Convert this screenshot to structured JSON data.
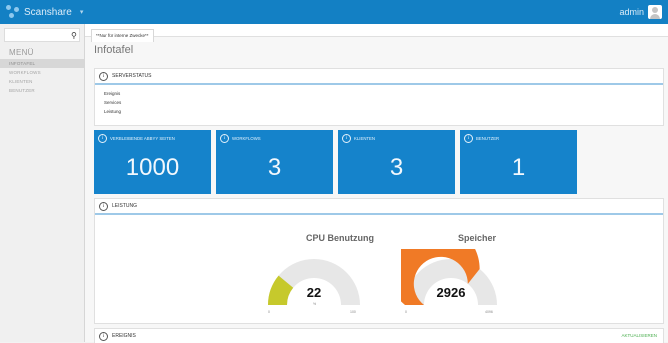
{
  "app": {
    "brand": "Scanshare",
    "user": "admin"
  },
  "sidebar": {
    "search_placeholder": "",
    "menu_title": "MENÜ",
    "items": [
      {
        "label": "INFOTAFEL"
      },
      {
        "label": "WORKFLOWS"
      },
      {
        "label": "KLIENTEN"
      },
      {
        "label": "BENUTZER"
      }
    ]
  },
  "tab": {
    "label": "**Nur für interne Zwecke**"
  },
  "page": {
    "title": "Infotafel"
  },
  "serverstatus": {
    "title": "SERVERSTATUS",
    "rows": [
      "Ereignis",
      "Services",
      "Leistung"
    ]
  },
  "tiles": [
    {
      "label": "VERBLEIBENDE ABBYY SEITEN",
      "value": "1000"
    },
    {
      "label": "WORKFLOWS",
      "value": "3"
    },
    {
      "label": "KLIENTEN",
      "value": "3"
    },
    {
      "label": "BENUTZER",
      "value": "1"
    }
  ],
  "leistung": {
    "title": "LEISTUNG",
    "gauges": [
      {
        "title": "CPU Benutzung",
        "value": "22",
        "unit": "%",
        "min": "0",
        "max": "100",
        "fraction": 0.22,
        "color": "#c6c92c"
      },
      {
        "title": "Speicher",
        "value": "2926",
        "unit": "",
        "min": "0",
        "max": "4096",
        "fraction": 0.714,
        "color": "#f07a26"
      }
    ]
  },
  "ereignis": {
    "title": "EREIGNIS",
    "refresh": "AKTUALISIEREN"
  },
  "colors": {
    "primary": "#1380c4",
    "tile": "#1583cb",
    "gauge_track": "#e7e7e7"
  }
}
